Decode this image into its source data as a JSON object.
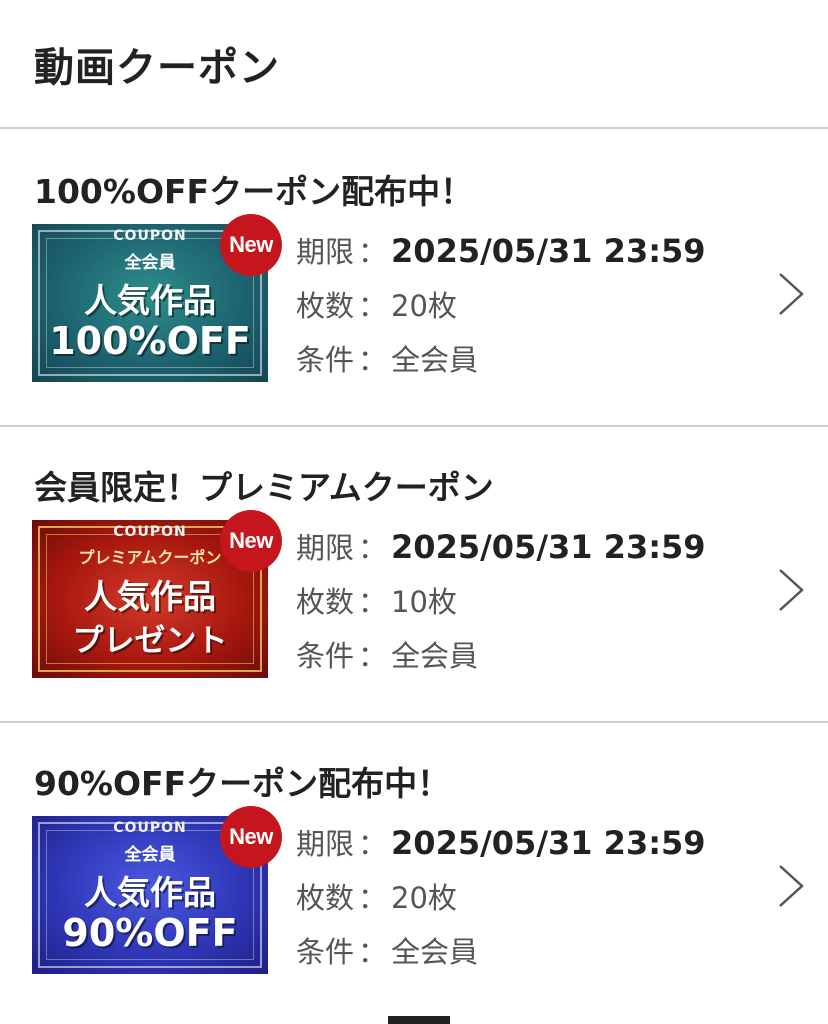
{
  "page": {
    "title": "動画クーポン"
  },
  "coupons": [
    {
      "title": "100%OFFクーポン配布中！",
      "banner": {
        "coupon": "COUPON",
        "sub": "全会員",
        "line1": "人気作品",
        "line2": "100%OFF",
        "theme_color": "#1d6470"
      },
      "badge": "New",
      "expiry_label": "期限",
      "expiry_value": "2025/05/31 23:59",
      "count_label": "枚数",
      "count_value": "20枚",
      "condition_label": "条件",
      "condition_value": "全会員"
    },
    {
      "title": "会員限定！プレミアムクーポン",
      "banner": {
        "coupon": "COUPON",
        "sub": "プレミアムクーポン",
        "line1": "人気作品",
        "line2": "プレゼント",
        "theme_color": "#a9180f"
      },
      "badge": "New",
      "expiry_label": "期限",
      "expiry_value": "2025/05/31 23:59",
      "count_label": "枚数",
      "count_value": "10枚",
      "condition_label": "条件",
      "condition_value": "全会員"
    },
    {
      "title": "90%OFFクーポン配布中！",
      "banner": {
        "coupon": "COUPON",
        "sub": "全会員",
        "line1": "人気作品",
        "line2": "90%OFF",
        "theme_color": "#2f37b7"
      },
      "badge": "New",
      "expiry_label": "期限",
      "expiry_value": "2025/05/31 23:59",
      "count_label": "枚数",
      "count_value": "20枚",
      "condition_label": "条件",
      "condition_value": "全会員"
    }
  ],
  "colors": {
    "badge": "#c5161d",
    "divider": "#cfcfcf",
    "text": "#222222",
    "muted": "#555555"
  },
  "icons": {
    "row_arrow": "chevron-right-icon"
  }
}
